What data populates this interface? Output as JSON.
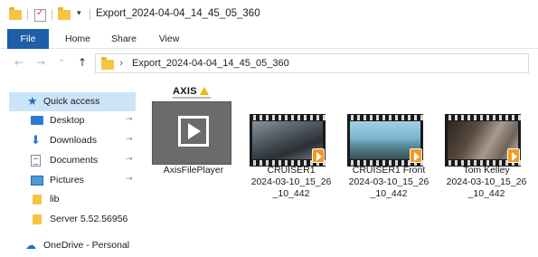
{
  "window": {
    "title": "Export_2024-04-04_14_45_05_360",
    "qat_arrow": "▾"
  },
  "ribbon": {
    "tabs": [
      "File",
      "Home",
      "Share",
      "View"
    ]
  },
  "address": {
    "back_icon": "←",
    "forward_icon": "→",
    "recent_icon": "⌄",
    "up_icon": "↑",
    "chevron": "›",
    "path": "Export_2024-04-04_14_45_05_360"
  },
  "navpane": {
    "items": [
      {
        "label": "Quick access",
        "icon": "star-icon",
        "glyph": "★"
      },
      {
        "label": "Desktop",
        "icon": "desktop-icon",
        "pinned": true
      },
      {
        "label": "Downloads",
        "icon": "download-icon",
        "glyph": "⬇",
        "pinned": true
      },
      {
        "label": "Documents",
        "icon": "documents-icon",
        "pinned": true
      },
      {
        "label": "Pictures",
        "icon": "pictures-icon",
        "pinned": true
      },
      {
        "label": "lib",
        "icon": "folder-icon"
      },
      {
        "label": "Server 5.52.56956",
        "icon": "folder-icon"
      },
      {
        "label": "OneDrive - Personal",
        "icon": "cloud-icon",
        "glyph": "☁"
      }
    ],
    "pin_glyph": "⊸"
  },
  "files": [
    {
      "name": "AxisFilePlayer",
      "logo": "AXIS",
      "type": "application"
    },
    {
      "name_lines": [
        "CRUISER1",
        "2024-03-10_15_26",
        "_10_442"
      ],
      "type": "video"
    },
    {
      "name_lines": [
        "CRUISER1 Front",
        "2024-03-10_15_26",
        "_10_442"
      ],
      "type": "video"
    },
    {
      "name_lines": [
        "Tom Kelley",
        "2024-03-10_15_26",
        "_10_442"
      ],
      "type": "video"
    }
  ],
  "colors": {
    "accent": "#1d5fa8",
    "selected": "#cce4f7",
    "folder": "#f5c542",
    "vlc": "#f29a1f"
  }
}
